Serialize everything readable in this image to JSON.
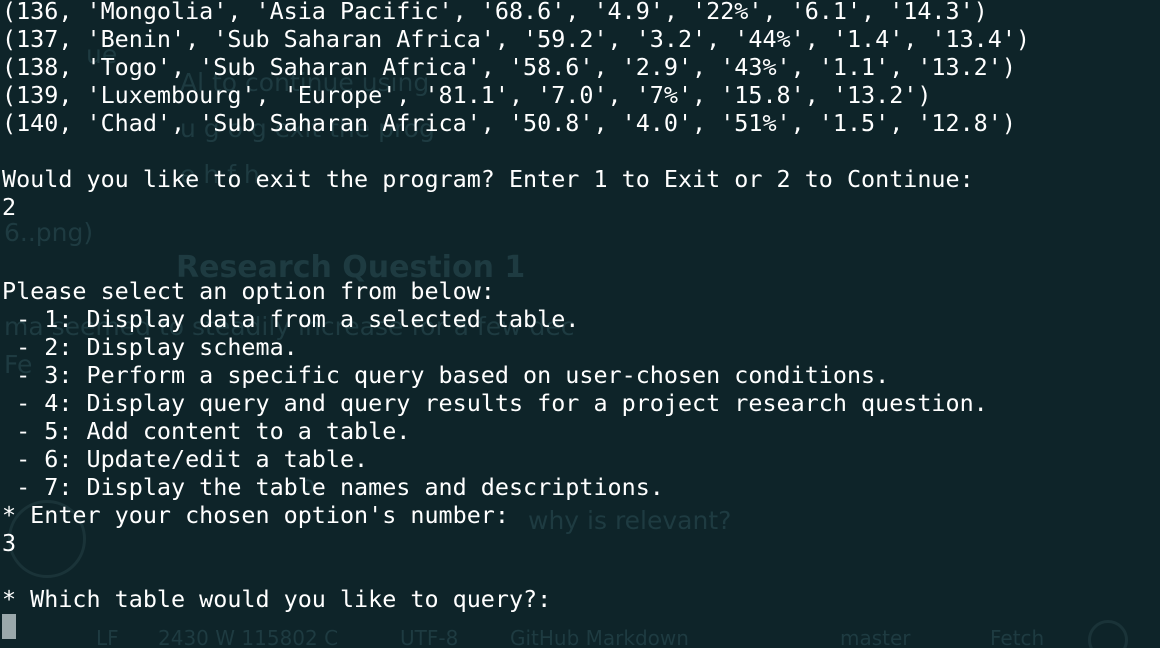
{
  "terminal": {
    "lines": [
      "(136, 'Mongolia', 'Asia Pacific', '68.6', '4.9', '22%', '6.1', '14.3')",
      "(137, 'Benin', 'Sub Saharan Africa', '59.2', '3.2', '44%', '1.4', '13.4')",
      "(138, 'Togo', 'Sub Saharan Africa', '58.6', '2.9', '43%', '1.1', '13.2')",
      "(139, 'Luxembourg', 'Europe', '81.1', '7.0', '7%', '15.8', '13.2')",
      "(140, 'Chad', 'Sub Saharan Africa', '50.8', '4.0', '51%', '1.5', '12.8')",
      "",
      "Would you like to exit the program? Enter 1 to Exit or 2 to Continue:",
      "2",
      "",
      "",
      "Please select an option from below:",
      " - 1: Display data from a selected table.",
      " - 2: Display schema.",
      " - 3: Perform a specific query based on user-chosen conditions.",
      " - 4: Display query and query results for a project research question.",
      " - 5: Add content to a table.",
      " - 6: Update/edit a table.",
      " - 7: Display the table names and descriptions.",
      "* Enter your chosen option's number:",
      "3",
      "",
      "* Which table would you like to query?:"
    ]
  },
  "background_editor": {
    "fragments": [
      "ue",
      "Al                                                              to continue using",
      "        u      g           o            g                         exit the prog",
      "          e   h                               f   h",
      "6..png)",
      "Research Question 1",
      "ma                                        seemed to steadily increase for a few dec",
      "Fe",
      "o",
      "why is relevant?"
    ],
    "status_bar": [
      "LF",
      "2430 W 115802 C",
      "UTF-8",
      "GitHub Markdown",
      "master",
      "Fetch",
      "GI"
    ]
  },
  "colors": {
    "background": "#0e2429",
    "text": "#ffffff",
    "cursor": "#9aa8ab",
    "ghost_text": "#1e3b41"
  }
}
